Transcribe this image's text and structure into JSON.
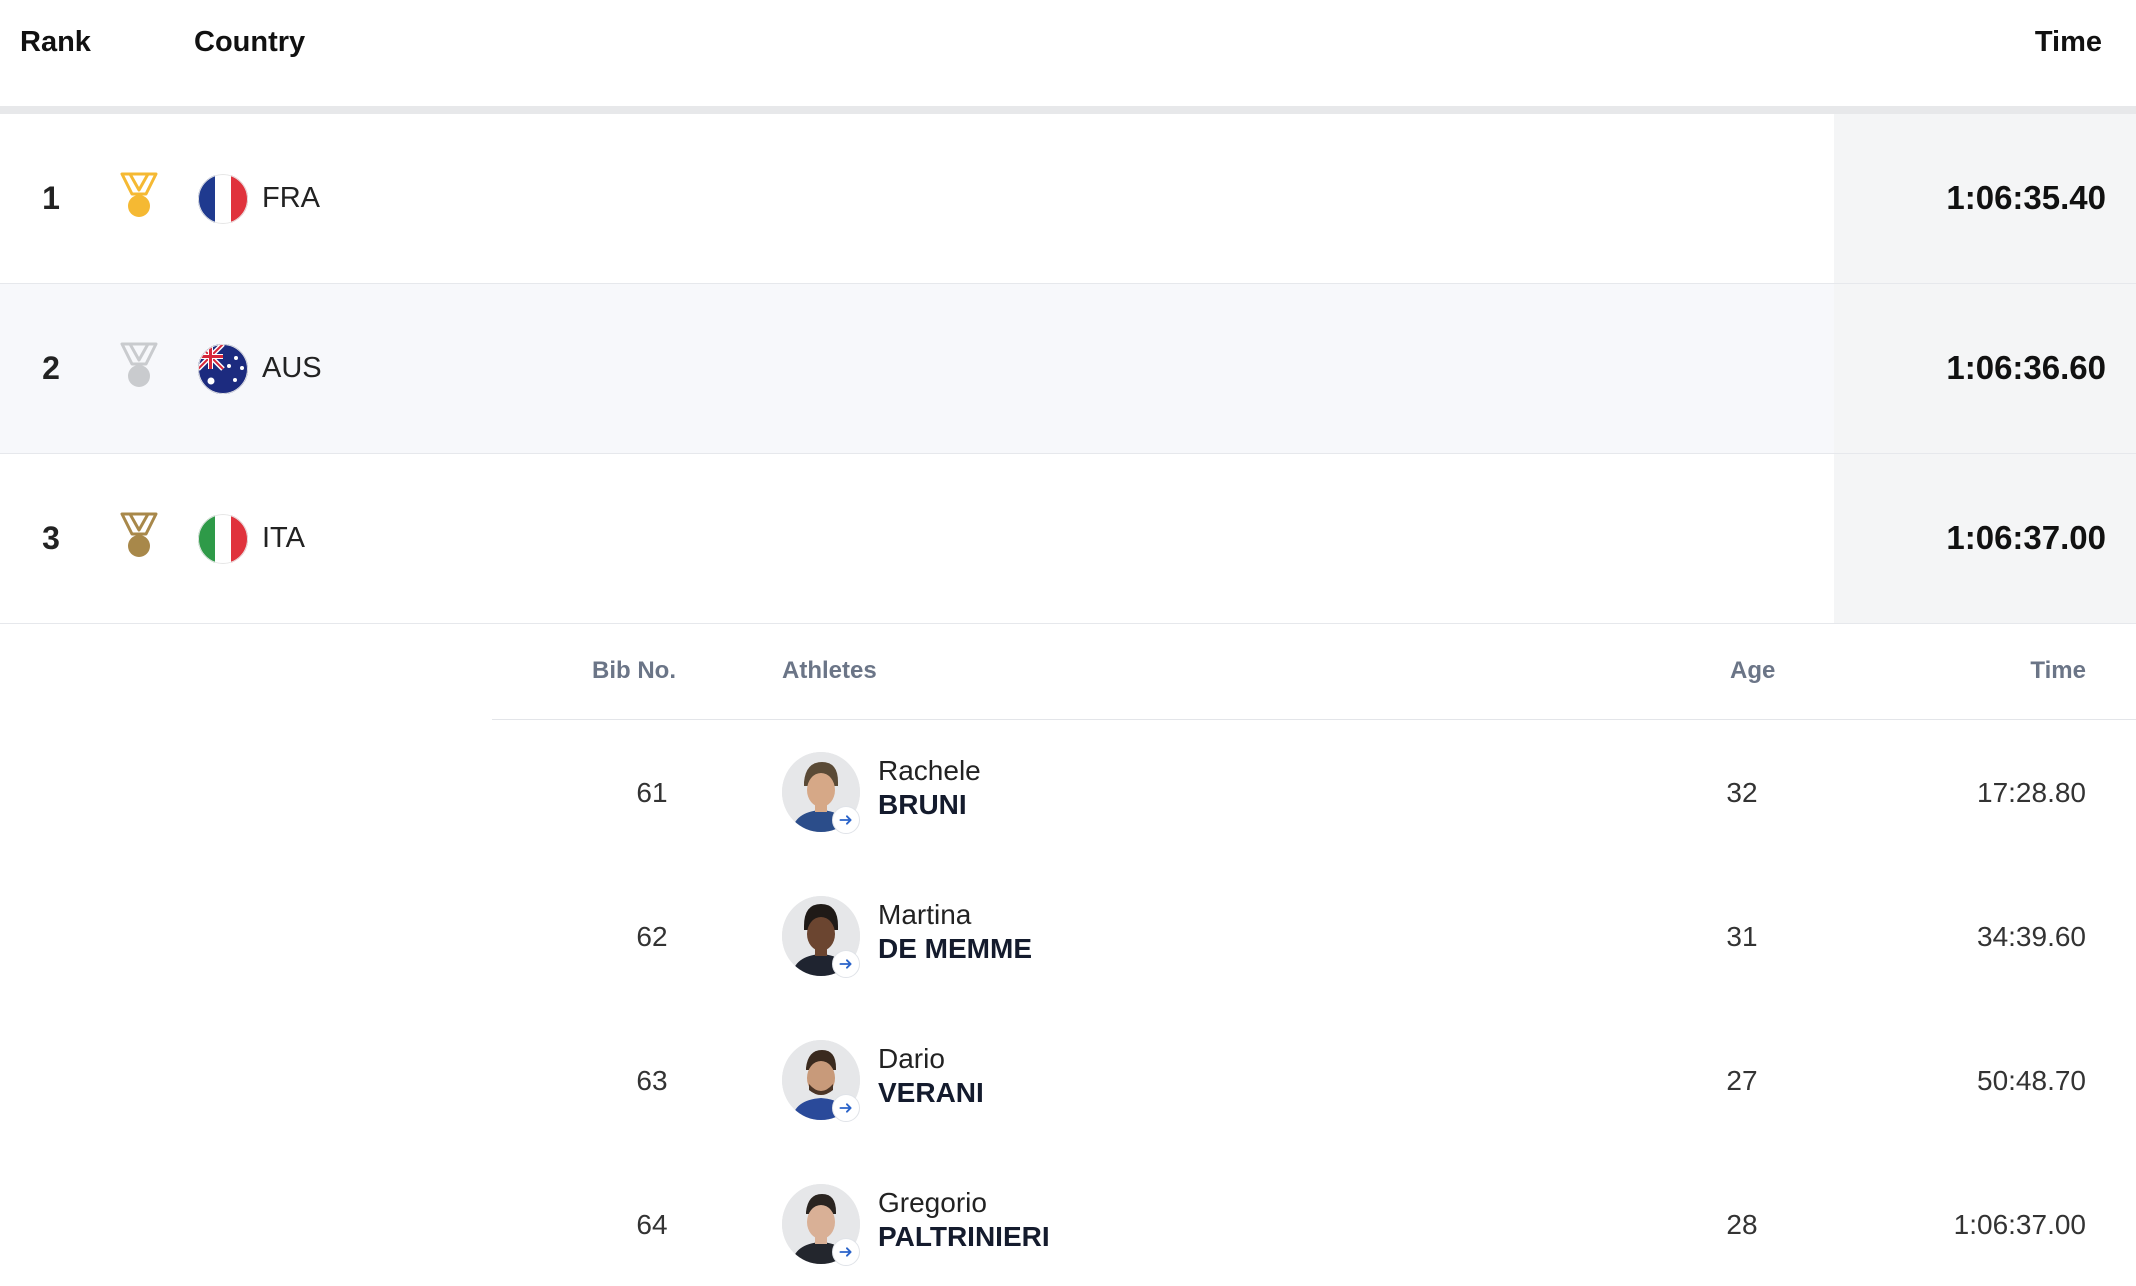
{
  "table": {
    "headers": {
      "rank": "Rank",
      "country": "Country",
      "time": "Time"
    },
    "rows": [
      {
        "rank": "1",
        "medal": "gold",
        "medal_color": "#f5b933",
        "flag": "france-flag-icon",
        "code": "FRA",
        "time": "1:06:35.40"
      },
      {
        "rank": "2",
        "medal": "silver",
        "medal_color": "#c9cbce",
        "flag": "australia-flag-icon",
        "code": "AUS",
        "time": "1:06:36.60"
      },
      {
        "rank": "3",
        "medal": "bronze",
        "medal_color": "#a8884a",
        "flag": "italy-flag-icon",
        "code": "ITA",
        "time": "1:06:37.00"
      }
    ]
  },
  "athletes_table": {
    "headers": {
      "bib": "Bib No.",
      "athletes": "Athletes",
      "age": "Age",
      "time": "Time"
    },
    "rows": [
      {
        "bib": "61",
        "first": "Rachele",
        "last": "BRUNI",
        "age": "32",
        "time": "17:28.80"
      },
      {
        "bib": "62",
        "first": "Martina",
        "last": "DE MEMME",
        "age": "31",
        "time": "34:39.60"
      },
      {
        "bib": "63",
        "first": "Dario",
        "last": "VERANI",
        "age": "27",
        "time": "50:48.70"
      },
      {
        "bib": "64",
        "first": "Gregorio",
        "last": "PALTRINIERI",
        "age": "28",
        "time": "1:06:37.00"
      }
    ]
  },
  "colors": {
    "accent_link": "#2a63c9",
    "header_divider": "#e7e8ea",
    "time_cell_bg": "#f4f5f6",
    "subheader_text": "#6b7587"
  }
}
